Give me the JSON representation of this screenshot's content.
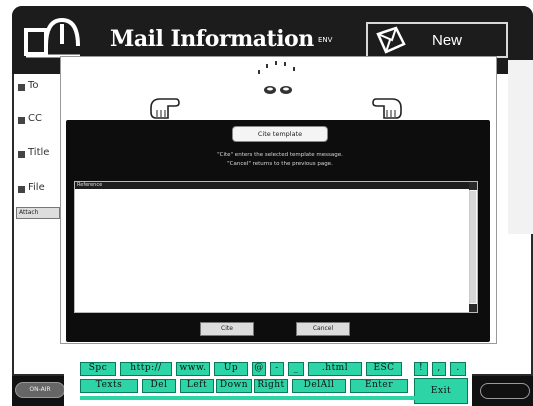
{
  "header": {
    "title": "Mail Information",
    "small_text": "ENV",
    "new_label": "New"
  },
  "fields": [
    {
      "label": "To"
    },
    {
      "label": "CC"
    },
    {
      "label": "Title"
    },
    {
      "label": "File"
    }
  ],
  "attach_button": "Attach",
  "dialog": {
    "title": "Cite template",
    "help_line1": "\"Cite\" enters the selected template message.",
    "help_line2": "\"Cancel\" returns to the previous page.",
    "list_header": "Reference",
    "enter_label": "Cite",
    "cancel_label": "Cancel"
  },
  "keyboard": {
    "row1": [
      "Spc",
      "http://",
      "www.",
      "Up",
      "@",
      "-",
      "_",
      ".html",
      "ESC",
      "!",
      ",",
      "."
    ],
    "row2": [
      "Texts",
      "Del",
      "Left",
      "Down",
      "Right",
      "DelAll",
      "Enter"
    ],
    "exit": "Exit"
  },
  "status": {
    "left_label": "ON-AIR"
  },
  "colors": {
    "key": "#2dd4a5",
    "header": "#1c1c1c",
    "dialog_dark": "#0d0d0d"
  }
}
